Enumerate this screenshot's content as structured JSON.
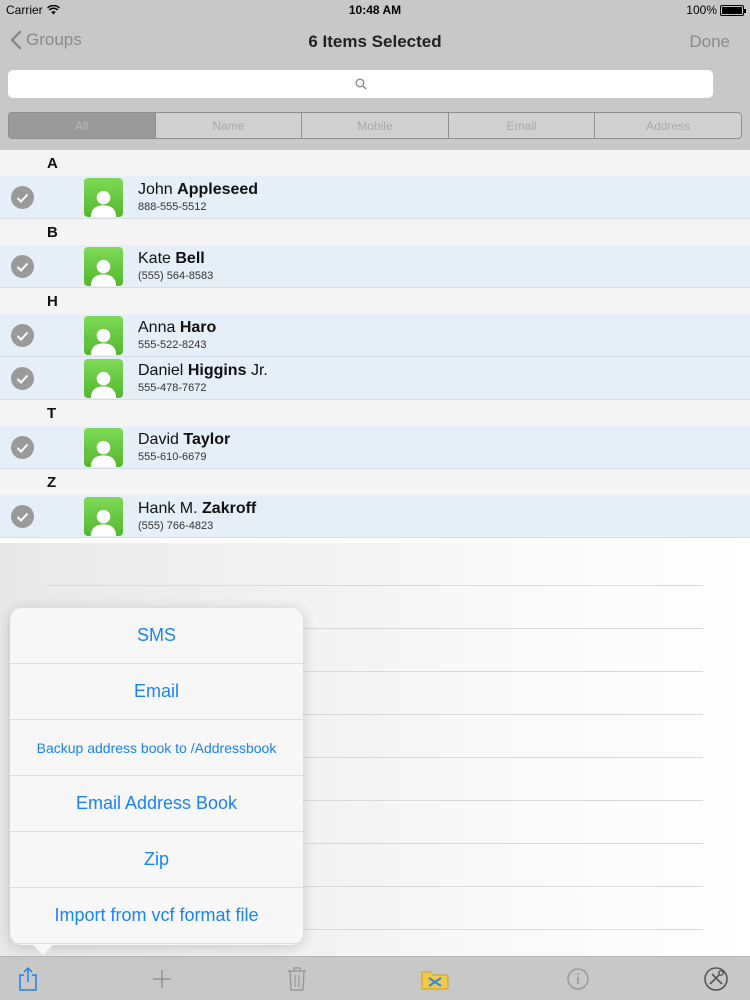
{
  "status_bar": {
    "carrier": "Carrier",
    "time": "10:48 AM",
    "battery": "100%"
  },
  "nav": {
    "back_label": "Groups",
    "title": "6 Items Selected",
    "done_label": "Done"
  },
  "search": {
    "placeholder": ""
  },
  "segments": [
    "All",
    "Name",
    "Mobile",
    "Email",
    "Address"
  ],
  "sections": [
    {
      "letter": "A",
      "contacts": [
        {
          "first": "John",
          "last": "Appleseed",
          "suffix": "",
          "phone": "888-555-5512"
        }
      ]
    },
    {
      "letter": "B",
      "contacts": [
        {
          "first": "Kate",
          "last": "Bell",
          "suffix": "",
          "phone": "(555) 564-8583"
        }
      ]
    },
    {
      "letter": "H",
      "contacts": [
        {
          "first": "Anna",
          "last": "Haro",
          "suffix": "",
          "phone": "555-522-8243"
        },
        {
          "first": "Daniel",
          "last": "Higgins",
          "suffix": "Jr.",
          "phone": "555-478-7672"
        }
      ]
    },
    {
      "letter": "T",
      "contacts": [
        {
          "first": "David",
          "last": "Taylor",
          "suffix": "",
          "phone": "555-610-6679"
        }
      ]
    },
    {
      "letter": "Z",
      "contacts": [
        {
          "first": "Hank M.",
          "last": "Zakroff",
          "suffix": "",
          "phone": "(555) 766-4823"
        }
      ]
    }
  ],
  "popover": {
    "items": [
      "SMS",
      "Email",
      "Backup address book to /Addressbook",
      "Email Address Book",
      "Zip",
      "Import from vcf format file"
    ]
  },
  "toolbar": {
    "icons": [
      "share-icon",
      "add-icon",
      "trash-icon",
      "folder-icon",
      "info-icon",
      "settings-icon"
    ]
  },
  "colors": {
    "accent": "#1a82f7",
    "bar": "#c8c8c8",
    "row": "#e6eef8",
    "avatar": "#6bcb43"
  }
}
